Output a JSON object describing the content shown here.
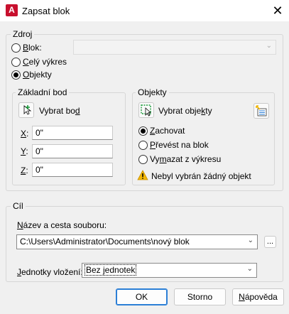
{
  "window": {
    "title": "Zapsat blok"
  },
  "source": {
    "legend": "Zdroj",
    "block_label": "Blok:",
    "block_value": "",
    "whole_drawing_label": "Celý výkres",
    "objects_label": "Objekty"
  },
  "base_point": {
    "legend": "Základní bod",
    "pick_label": "Vybrat bod",
    "x_label": "X:",
    "x_value": "0\"",
    "y_label": "Y:",
    "y_value": "0\"",
    "z_label": "Z:",
    "z_value": "0\""
  },
  "objects": {
    "legend": "Objekty",
    "select_label": "Vybrat objekty",
    "retain_label": "Zachovat",
    "convert_label": "Převést na blok",
    "delete_label": "Vymazat z výkresu",
    "warning_text": "Nebyl vybrán žádný objekt"
  },
  "destination": {
    "legend": "Cíl",
    "path_label": "Název a cesta souboru:",
    "path_value": "C:\\Users\\Administrator\\Documents\\nový blok",
    "browse_label": "...",
    "units_label": "Jednotky vložení:",
    "units_value": "Bez jednotek"
  },
  "buttons": {
    "ok": "OK",
    "cancel": "Storno",
    "help": "Nápověda"
  },
  "colors": {
    "accent": "#2c7fd6",
    "app_icon": "#c8102e",
    "warning": "#f2b705"
  }
}
